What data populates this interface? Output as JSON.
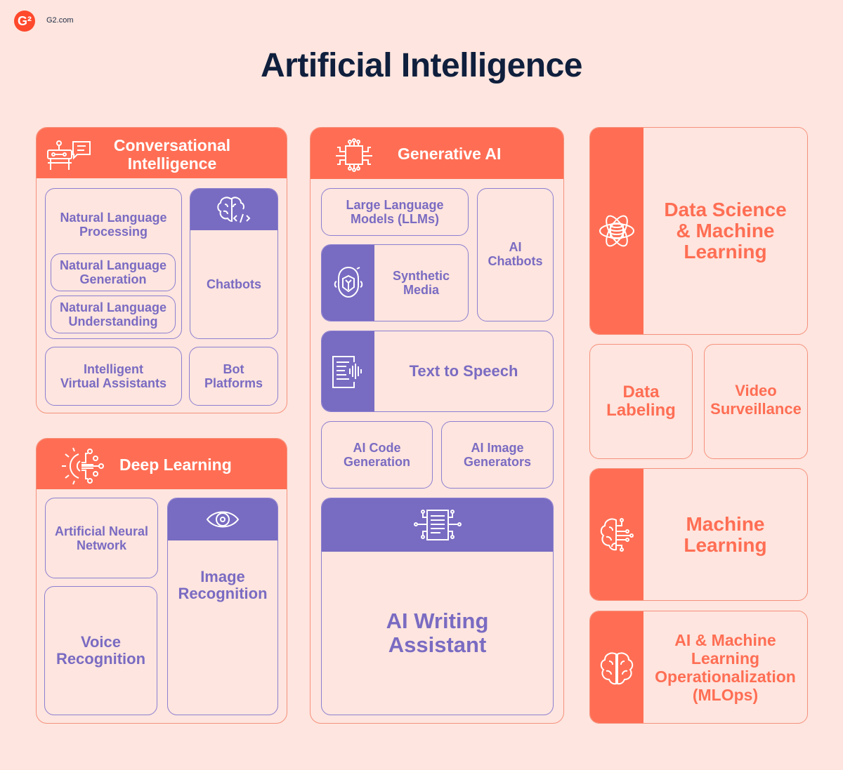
{
  "header": {
    "logo_glyph": "G²",
    "logo_text": "G2.com",
    "title": "Artificial Intelligence"
  },
  "colors": {
    "background": "#fee5df",
    "orange": "#ff6e54",
    "purple": "#786bc2",
    "title": "#0f1f3d"
  },
  "conversational": {
    "title_line1": "Conversational",
    "title_line2": "Intelligence",
    "icon": "robot-chat-icon",
    "nlp": "Natural Language Processing",
    "nlg": "Natural Language Generation",
    "nlu": "Natural Language Understanding",
    "chatbots": "Chatbots",
    "chatbots_icon": "brain-code-icon",
    "iva_line1": "Intelligent",
    "iva_line2": "Virtual Assistants",
    "bot_line1": "Bot",
    "bot_line2": "Platforms"
  },
  "deep_learning": {
    "title": "Deep Learning",
    "icon": "neural-sun-icon",
    "ann_line1": "Artificial Neural",
    "ann_line2": "Network",
    "voice_line1": "Voice",
    "voice_line2": "Recognition",
    "image_line1": "Image",
    "image_line2": "Recognition",
    "image_icon": "eye-icon"
  },
  "generative": {
    "title": "Generative AI",
    "icon": "chip-icon",
    "llm_line1": "Large Language",
    "llm_line2": "Models (LLMs)",
    "synthetic_line1": "Synthetic",
    "synthetic_line2": "Media",
    "synthetic_icon": "face-scan-icon",
    "ai_chatbots_line1": "AI",
    "ai_chatbots_line2": "Chatbots",
    "tts": "Text to Speech",
    "tts_icon": "document-audio-icon",
    "code_line1": "AI Code",
    "code_line2": "Generation",
    "imggen_line1": "AI Image",
    "imggen_line2": "Generators",
    "writing_line1": "AI Writing",
    "writing_line2": "Assistant",
    "writing_icon": "document-circuit-icon"
  },
  "right": {
    "dsml_line1": "Data Science",
    "dsml_line2": "& Machine",
    "dsml_line3": "Learning",
    "dsml_icon": "atom-database-icon",
    "labeling_line1": "Data",
    "labeling_line2": "Labeling",
    "video_line1": "Video",
    "video_line2": "Surveillance",
    "ml_line1": "Machine",
    "ml_line2": "Learning",
    "ml_icon": "brain-circuit-icon",
    "mlops_line1": "AI & Machine",
    "mlops_line2": "Learning",
    "mlops_line3": "Operationalization",
    "mlops_line4": "(MLOps)",
    "mlops_icon": "brain-icon"
  }
}
